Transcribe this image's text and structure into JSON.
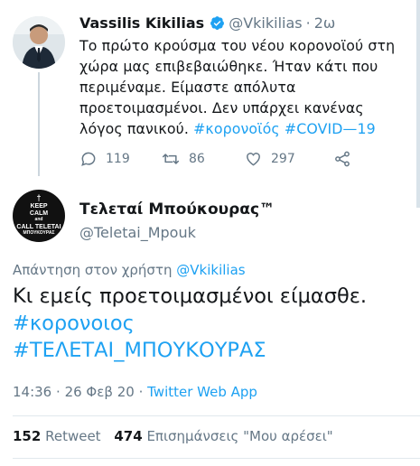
{
  "reply_tweet": {
    "author_name": "Vassilis Kikilias",
    "handle": "@Vkikilias",
    "separator": "·",
    "time": "2ω",
    "body_lines": [
      "Το πρώτο κρούσμα του νέου κορονοϊού στη",
      "χώρα μας επιβεβαιώθηκε. Ήταν κάτι που",
      "περιμέναμε. Είμαστε απόλυτα",
      "προετοιμασμένοι. Δεν υπάρχει κανένας",
      "λόγος πανικού."
    ],
    "hashtags": [
      "#κορονοϊός",
      "#COVID—19"
    ],
    "replies": "119",
    "retweets": "86",
    "likes": "297"
  },
  "main_tweet": {
    "author_name": "Τελεταί Μπούκουρας™",
    "handle": "@Teletai_Mpouk",
    "avatar_text": {
      "cross": "†",
      "lines": [
        "KEEP",
        "CALM",
        "and",
        "CALL TELETAI",
        "ΜΠΟΥΚΟΥΡΑΣ"
      ]
    },
    "reply_prefix": "Απάντηση στον χρήστη",
    "reply_handle": "@Vkikilias",
    "text_line": "Κι εμείς προετοιμασμένοι είμασθε.",
    "hashtags": [
      "#κορονοιος",
      "#ΤΕΛΕΤΑΙ_ΜΠΟΥΚΟΥΡΑΣ"
    ],
    "time": "14:36",
    "date": "26 Φεβ 20",
    "separator": "·",
    "source": "Twitter Web App",
    "retweet_count": "152",
    "retweet_label": "Retweet",
    "likes_count": "474",
    "likes_label": "Επισημάνσεις \"Μου αρέσει\""
  },
  "colors": {
    "accent": "#1da1f2",
    "muted": "#657786",
    "text": "#14171a",
    "divider": "#e1e8ed"
  },
  "icons": [
    "verified-badge-icon",
    "reply-icon",
    "retweet-icon",
    "like-icon",
    "share-icon"
  ]
}
